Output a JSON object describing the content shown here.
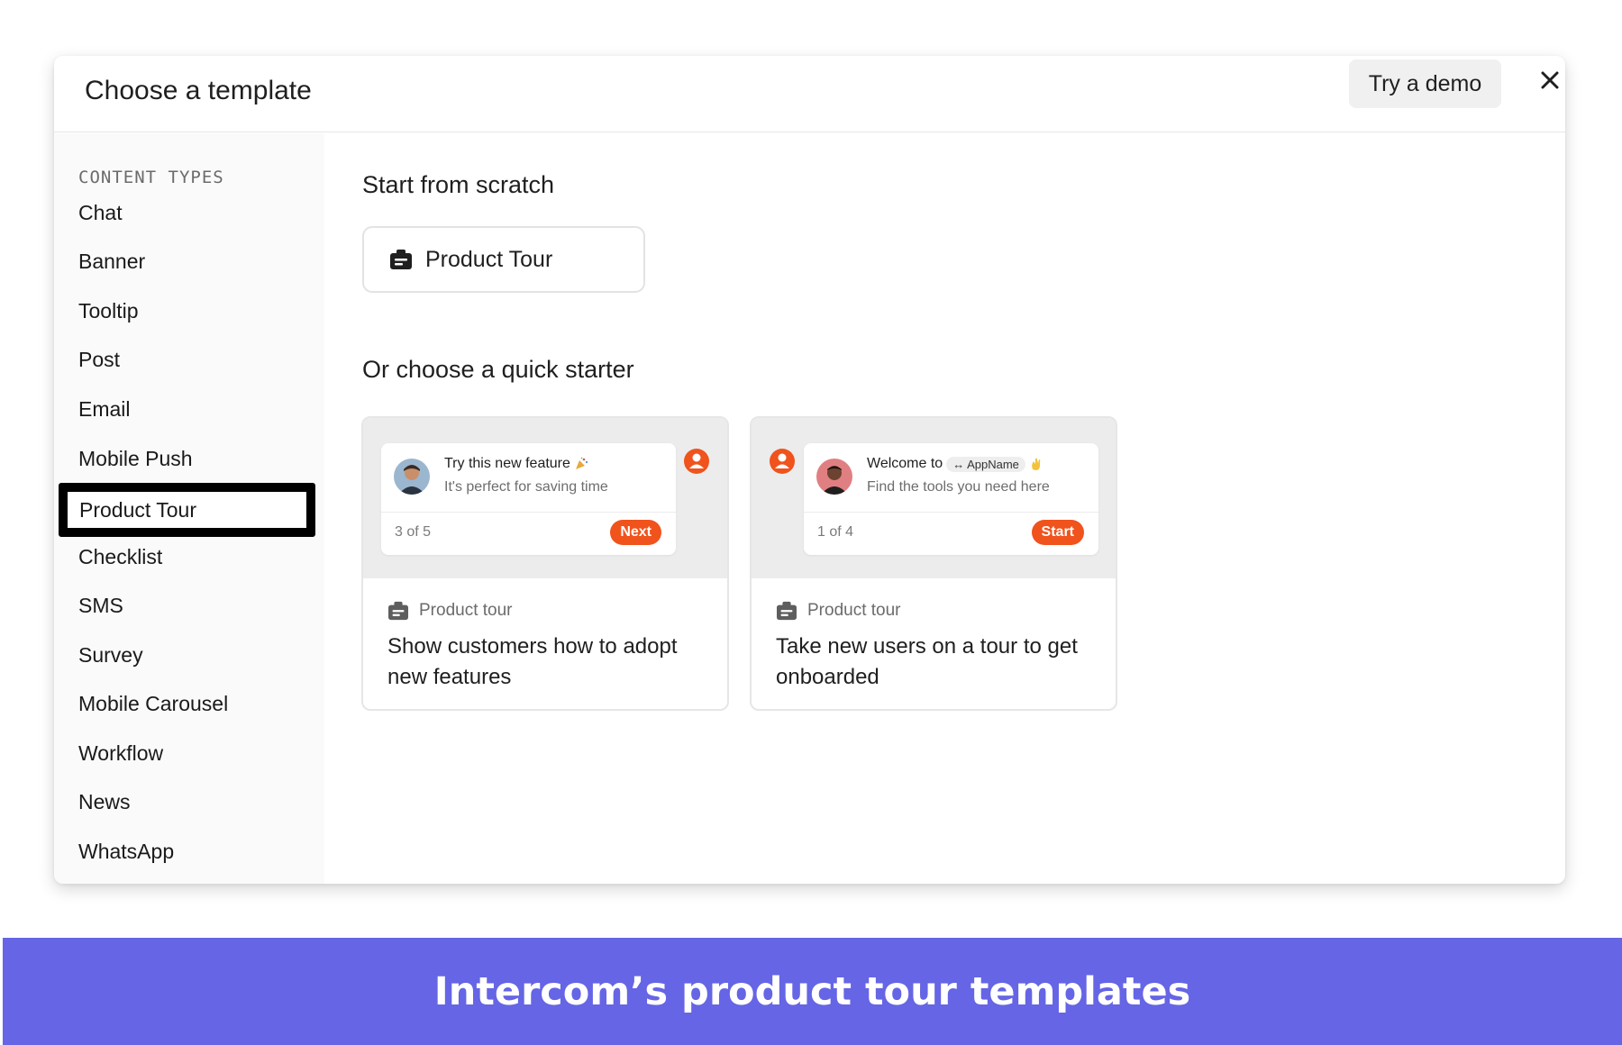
{
  "modal": {
    "title": "Choose a template",
    "demo_button": "Try a demo"
  },
  "sidebar": {
    "heading": "CONTENT TYPES",
    "items": [
      {
        "label": "Chat"
      },
      {
        "label": "Banner"
      },
      {
        "label": "Tooltip"
      },
      {
        "label": "Post"
      },
      {
        "label": "Email"
      },
      {
        "label": "Mobile Push"
      },
      {
        "label": "Product Tour",
        "active": true
      },
      {
        "label": "Checklist"
      },
      {
        "label": "SMS"
      },
      {
        "label": "Survey"
      },
      {
        "label": "Mobile Carousel"
      },
      {
        "label": "Workflow"
      },
      {
        "label": "News"
      },
      {
        "label": "WhatsApp"
      }
    ]
  },
  "main": {
    "scratch_title": "Start from scratch",
    "scratch_button": "Product Tour",
    "quick_title": "Or choose a quick starter",
    "cards": [
      {
        "preview_title": "Try this new feature",
        "preview_sub": "It's perfect for saving time",
        "step": "3 of 5",
        "action": "Next",
        "type_label": "Product tour",
        "description": "Show customers how to adopt new features"
      },
      {
        "preview_title": "Welcome to",
        "preview_chip": "↔ AppName",
        "preview_sub": "Find the tools you need here",
        "step": "1 of 4",
        "action": "Start",
        "type_label": "Product tour",
        "description": "Take new users on a tour to get onboarded"
      }
    ]
  },
  "colors": {
    "accent": "#f0531c",
    "banner": "#6565e5"
  },
  "icons": [
    "close-icon",
    "tour-icon",
    "person-icon",
    "party-icon",
    "wave-icon"
  ],
  "footer": {
    "caption": "Intercom’s product tour templates"
  }
}
